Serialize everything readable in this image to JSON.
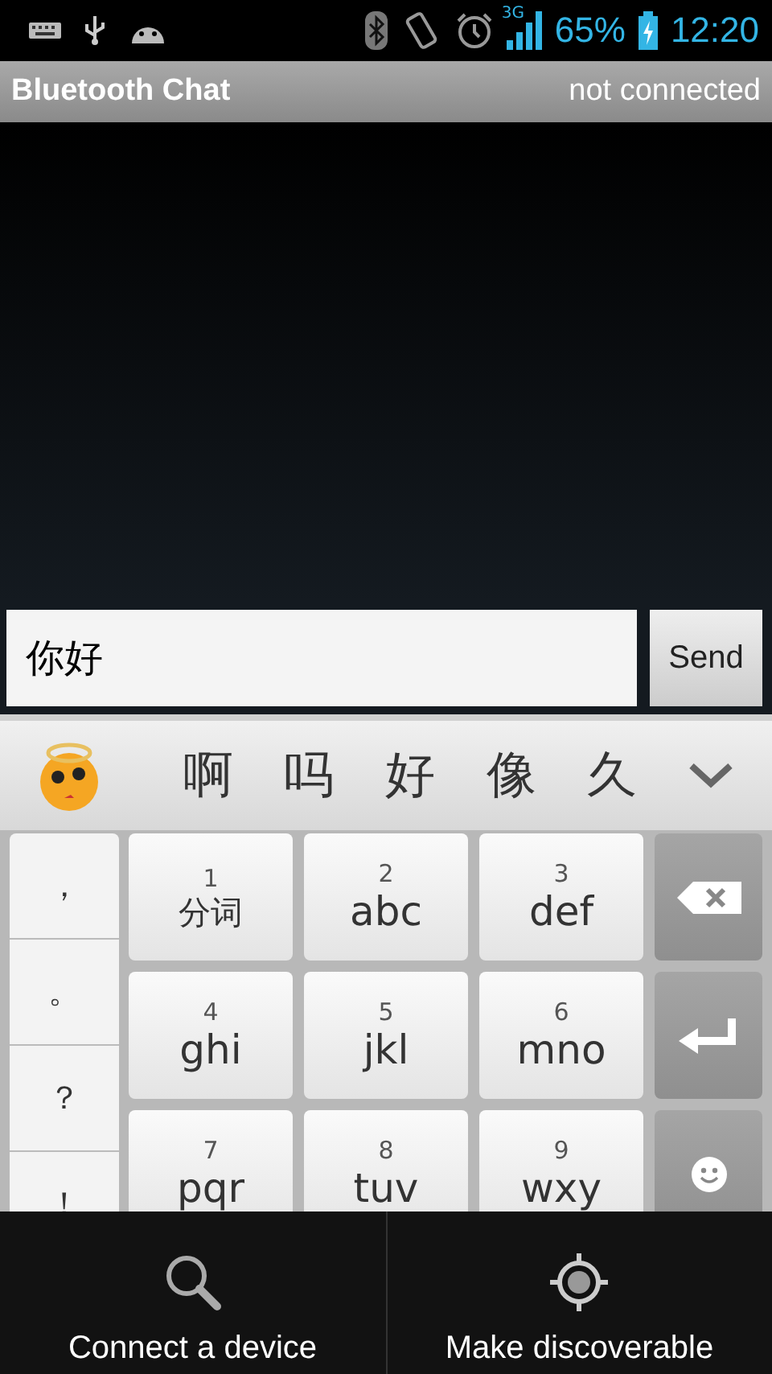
{
  "status_bar": {
    "network": "3G",
    "battery": "65%",
    "time": "12:20"
  },
  "title_bar": {
    "title": "Bluetooth Chat",
    "status": "not connected"
  },
  "compose": {
    "value": "你好",
    "send_button": "Send"
  },
  "candidates": [
    "啊",
    "吗",
    "好",
    "像",
    "久"
  ],
  "keyboard": {
    "symbols": [
      "，",
      "。",
      "？",
      "！"
    ],
    "rows": [
      [
        {
          "kind": "t9",
          "number": "1",
          "label": "分词"
        },
        {
          "kind": "t9",
          "number": "2",
          "label": "abc"
        },
        {
          "kind": "t9",
          "number": "3",
          "label": "def"
        },
        {
          "kind": "backspace"
        }
      ],
      [
        {
          "kind": "t9",
          "number": "4",
          "label": "ghi"
        },
        {
          "kind": "t9",
          "number": "5",
          "label": "jkl"
        },
        {
          "kind": "t9",
          "number": "6",
          "label": "mno"
        },
        {
          "kind": "enter"
        }
      ],
      [
        {
          "kind": "t9",
          "number": "7",
          "label": "pqr"
        },
        {
          "kind": "t9",
          "number": "8",
          "label": "tuv"
        },
        {
          "kind": "t9",
          "number": "9",
          "label": "wxy"
        },
        {
          "kind": "emoji"
        }
      ]
    ]
  },
  "options_menu": [
    {
      "kind": "search",
      "label": "Connect a device"
    },
    {
      "kind": "discoverable",
      "label": "Make discoverable"
    }
  ]
}
